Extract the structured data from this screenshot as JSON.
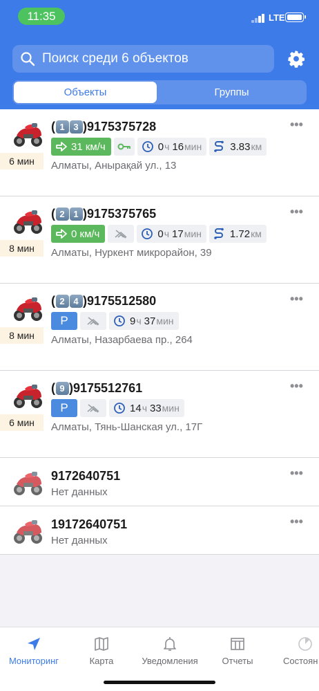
{
  "status_bar": {
    "time": "11:35",
    "network": "LTE"
  },
  "search": {
    "placeholder": "Поиск среди 6 объектов"
  },
  "segments": {
    "objects": "Объекты",
    "groups": "Группы"
  },
  "units": [
    {
      "badges": [
        "1",
        "3"
      ],
      "id": "9175375728",
      "ago": "6 мин",
      "mode": "moving",
      "speed": "31 км/ч",
      "ignition": "on",
      "duration": {
        "h": "0",
        "hu": "ч",
        "m": "16",
        "mu": "мин"
      },
      "distance": {
        "value": "3.83",
        "unit": "км"
      },
      "address": "Алматы, Анырақай ул., 13"
    },
    {
      "badges": [
        "2",
        "1"
      ],
      "id": "9175375765",
      "ago": "8 мин",
      "mode": "moving",
      "speed": "0 км/ч",
      "ignition": "no-signal",
      "duration": {
        "h": "0",
        "hu": "ч",
        "m": "17",
        "mu": "мин"
      },
      "distance": {
        "value": "1.72",
        "unit": "км"
      },
      "address": "Алматы, Нуркент микрорайон, 39"
    },
    {
      "badges": [
        "2",
        "4"
      ],
      "id": "9175512580",
      "ago": "8 мин",
      "mode": "parked",
      "park_label": "P",
      "ignition": "no-signal",
      "duration": {
        "h": "9",
        "hu": "ч",
        "m": "37",
        "mu": "мин"
      },
      "address": "Алматы, Назарбаева пр., 264"
    },
    {
      "badges": [
        "9"
      ],
      "id": "9175512761",
      "ago": "6 мин",
      "mode": "parked",
      "park_label": "P",
      "ignition": "no-signal",
      "duration": {
        "h": "14",
        "hu": "ч",
        "m": "33",
        "mu": "мин"
      },
      "address": "Алматы, Тянь-Шанская ул., 17Г"
    },
    {
      "id": "9172640751",
      "status": "Нет данных"
    },
    {
      "id": "19172640751",
      "status": "Нет данных"
    }
  ],
  "tabs": [
    {
      "label": "Мониторинг",
      "icon": "navigation-arrow-icon",
      "active": true
    },
    {
      "label": "Карта",
      "icon": "map-icon",
      "active": false
    },
    {
      "label": "Уведомления",
      "icon": "bell-icon",
      "active": false
    },
    {
      "label": "Отчеты",
      "icon": "report-table-icon",
      "active": false
    },
    {
      "label": "Состоян",
      "icon": "pie-chart-icon",
      "active": false
    }
  ],
  "colors": {
    "header": "#3d7be8",
    "speed_chip": "#5cb85c",
    "park_chip": "#4a8be0",
    "ago_bg": "#fdf3e3",
    "time_pill": "#4cc35e"
  }
}
